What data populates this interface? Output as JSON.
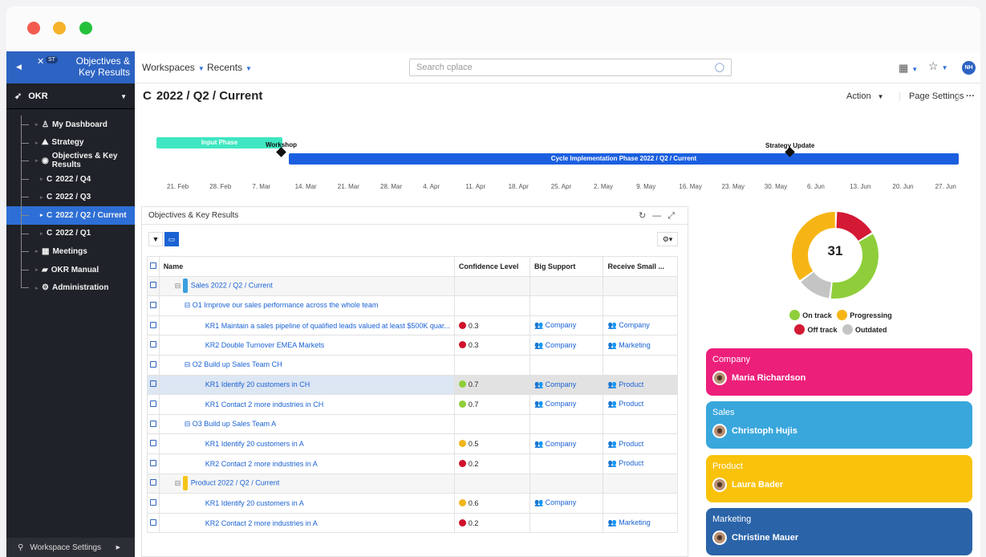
{
  "window": {
    "title": "Objectives & Key Results",
    "badge": "ST"
  },
  "sidebar": {
    "section": "OKR",
    "items": [
      {
        "label": "My Dashboard",
        "icon": "person-icon"
      },
      {
        "label": "Strategy",
        "icon": "strategy-icon"
      },
      {
        "label": "Objectives & Key Results",
        "icon": "target-icon"
      },
      {
        "label": "2022 / Q4",
        "icon": "refresh-icon"
      },
      {
        "label": "2022 / Q3",
        "icon": "refresh-icon"
      },
      {
        "label": "2022 / Q2 / Current",
        "icon": "refresh-icon",
        "selected": true
      },
      {
        "label": "2022 / Q1",
        "icon": "refresh-icon"
      },
      {
        "label": "Meetings",
        "icon": "calendar-icon"
      },
      {
        "label": "OKR Manual",
        "icon": "book-icon"
      },
      {
        "label": "Administration",
        "icon": "cogs-icon"
      }
    ],
    "footer": "Workspace Settings"
  },
  "topnav": {
    "workspaces": "Workspaces",
    "recents": "Recents",
    "search_placeholder": "Search cplace",
    "avatar": "NH"
  },
  "page": {
    "title": "2022 / Q2 / Current",
    "action": "Action",
    "settings": "Page Settings",
    "more": "···"
  },
  "timeline": {
    "input_phase": "Input Phase",
    "impl_phase": "Cycle Implementation Phase 2022 / Q2 / Current",
    "milestones": [
      "Workshop",
      "Strategy Update"
    ],
    "ticks": [
      "21. Feb",
      "28. Feb",
      "7. Mar",
      "14. Mar",
      "21. Mar",
      "28. Mar",
      "4. Apr",
      "11. Apr",
      "18. Apr",
      "25. Apr",
      "2. May",
      "9. May",
      "16. May",
      "23. May",
      "30. May",
      "6. Jun",
      "13. Jun",
      "20. Jun",
      "27. Jun"
    ]
  },
  "panel": {
    "title": "Objectives & Key Results",
    "columns": [
      "Name",
      "Confidence Level",
      "Big Support",
      "Receive Small ..."
    ],
    "rows": [
      {
        "type": "group",
        "name": "Sales 2022 / Q2 / Current",
        "color": "#3a9fe0"
      },
      {
        "type": "objective",
        "name": "O1 Improve our sales performance across the whole team"
      },
      {
        "type": "kr",
        "name": "KR1 Maintain a sales pipeline of qualified leads valued at least $500K quar...",
        "conf": "0.3",
        "confColor": "#d0102a",
        "big": "Company",
        "small": "Company"
      },
      {
        "type": "kr",
        "name": "KR2 Double Turnover EMEA Markets",
        "conf": "0.3",
        "confColor": "#d0102a",
        "big": "Company",
        "small": "Marketing"
      },
      {
        "type": "objective",
        "name": "O2 Build up Sales Team CH"
      },
      {
        "type": "kr",
        "name": "KR1 Identify 20 customers in CH",
        "conf": "0.7",
        "confColor": "#8fce3a",
        "big": "Company",
        "small": "Product",
        "hl": true
      },
      {
        "type": "kr",
        "name": "KR1 Contact 2 more industries in CH",
        "conf": "0.7",
        "confColor": "#8fce3a",
        "big": "Company",
        "small": "Product"
      },
      {
        "type": "objective",
        "name": "O3 Build up Sales Team A"
      },
      {
        "type": "kr",
        "name": "KR1 Identify 20 customers in A",
        "conf": "0.5",
        "confColor": "#f2b51c",
        "big": "Company",
        "small": "Product"
      },
      {
        "type": "kr",
        "name": "KR2 Contact 2 more industries in A",
        "conf": "0.2",
        "confColor": "#d0102a",
        "big": "",
        "small": "Product"
      },
      {
        "type": "group",
        "name": "Product 2022 / Q2 / Current",
        "color": "#f5c518"
      },
      {
        "type": "kr",
        "name": "KR1 Identify 20 customers in A",
        "conf": "0.6",
        "confColor": "#f2b51c",
        "big": "Company",
        "small": ""
      },
      {
        "type": "kr",
        "name": "KR2 Contact 2 more industries in A",
        "conf": "0.2",
        "confColor": "#d0102a",
        "big": "",
        "small": "Marketing"
      }
    ]
  },
  "donut": {
    "total": "31",
    "segments": [
      {
        "label": "On track",
        "value": 11,
        "color": "#8fce3a"
      },
      {
        "label": "Progressing",
        "value": 11,
        "color": "#f7b515"
      },
      {
        "label": "Off track",
        "value": 5,
        "color": "#d41935"
      },
      {
        "label": "Outdated",
        "value": 4,
        "color": "#c4c4c4"
      }
    ],
    "legend": [
      "On track",
      "Progressing",
      "Off track",
      "Outdated"
    ]
  },
  "cards": [
    {
      "title": "Company",
      "person": "Maria Richardson",
      "color": "#ec1f7b"
    },
    {
      "title": "Sales",
      "person": "Christoph Hujis",
      "color": "#39a7dc"
    },
    {
      "title": "Product",
      "person": "Laura Bader",
      "color": "#f9c20b"
    },
    {
      "title": "Marketing",
      "person": "Christine Mauer",
      "color": "#2a63a8"
    }
  ]
}
